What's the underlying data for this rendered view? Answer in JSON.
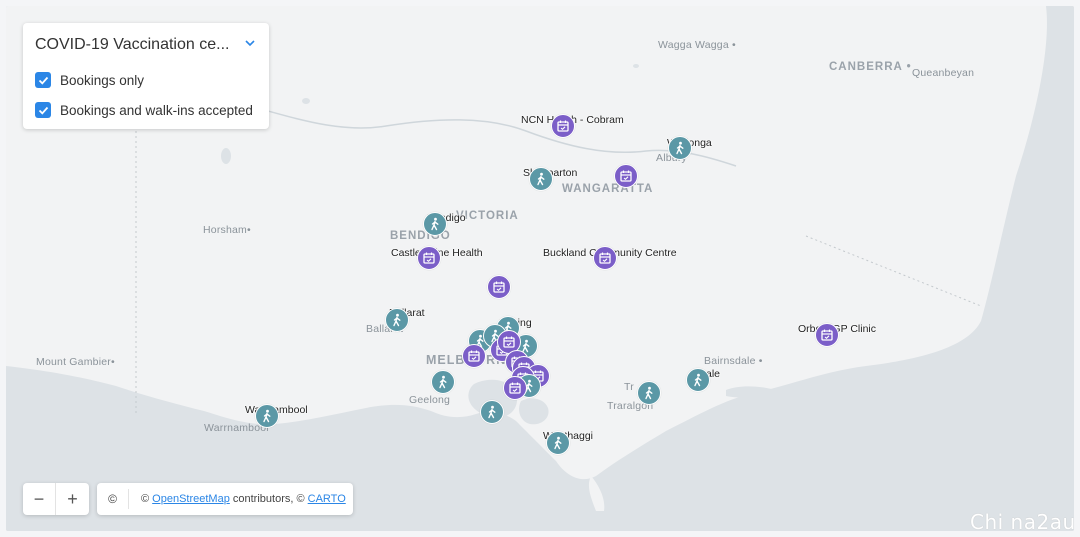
{
  "legend": {
    "title": "COVID-19 Vaccination ce...",
    "options": [
      {
        "label": "Bookings only",
        "checked": true
      },
      {
        "label": "Bookings and walk-ins accepted",
        "checked": true
      }
    ]
  },
  "places": {
    "wagga": "Wagga Wagga",
    "canberra": "CANBERRA",
    "queanbeyan": "Queanbeyan",
    "horsham": "Horsham",
    "victoria": "VICTORIA",
    "bendigo_town": "BENDIGO",
    "ballarat_town": "Ballarat",
    "melbourne": "MELBOURNE",
    "mount_gambier": "Mount Gambier",
    "bairnsdale": "Bairnsdale",
    "traralgon": "Traralgon",
    "geelong": "Geelong",
    "warrnambool_town": "Warrnambool",
    "albury": "Albury",
    "wangaratta": "WANGARATTA",
    "tr": "Tr"
  },
  "sites": {
    "ncn": "NCN Health - Cobram",
    "wodonga": "Wodonga",
    "shepparton": "Shepparton",
    "bendigo": "Bendigo",
    "castlemaine": "Castlemaine Health",
    "buckland": "Buckland Community Centre",
    "ballarat": "Ballarat",
    "epping": "Epping",
    "orbost": "Orbost GP Clinic",
    "sale": "Sale",
    "warrnambool": "Warrnambool",
    "wonthaggi": "Wonthaggi"
  },
  "marker_types": {
    "booking": "Bookings only",
    "walkin": "Bookings and walk-ins accepted"
  },
  "colors": {
    "booking": "#7b5ec8",
    "walkin": "#5b98a6",
    "accent": "#2b86e6"
  },
  "zoom": {
    "minus": "−",
    "plus": "+"
  },
  "attribution": {
    "icon": "©",
    "prefix": "©",
    "osm": "OpenStreetMap",
    "mid": "contributors, ©",
    "carto": "CARTO"
  },
  "watermark": "Chi na2au"
}
